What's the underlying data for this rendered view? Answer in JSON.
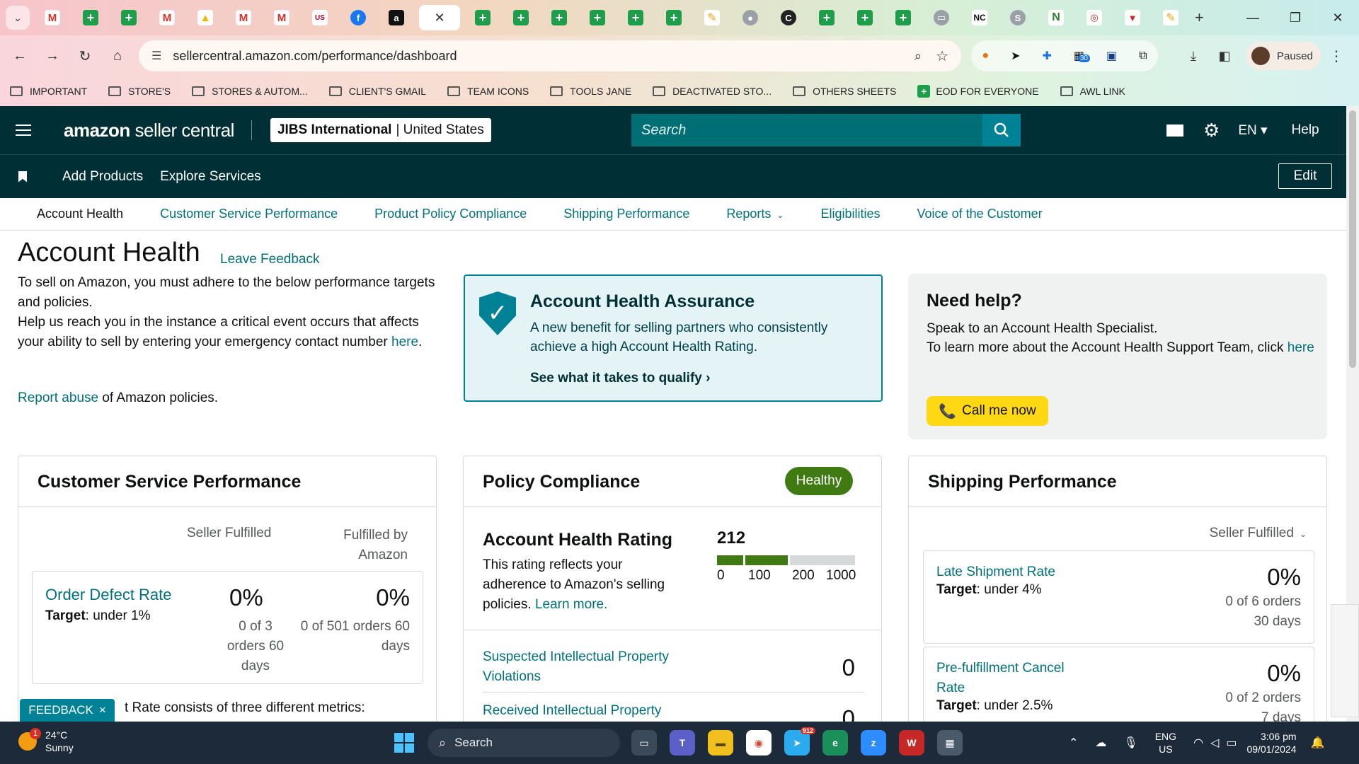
{
  "browser": {
    "url": "sellercentral.amazon.com/performance/dashboard",
    "profile_status": "Paused",
    "extension_badge": "30",
    "tabs": [
      {
        "icon": "gmail-icon",
        "glyph": "M",
        "kind": "gmail"
      },
      {
        "icon": "sheets-icon",
        "glyph": "+",
        "kind": "sheet"
      },
      {
        "icon": "sheets-icon",
        "glyph": "+",
        "kind": "sheet"
      },
      {
        "icon": "gmail-icon",
        "glyph": "M",
        "kind": "gmail"
      },
      {
        "icon": "drive-icon",
        "glyph": "▲",
        "kind": "drive"
      },
      {
        "icon": "gmail-icon",
        "glyph": "M",
        "kind": "gmail"
      },
      {
        "icon": "gmail-icon",
        "glyph": "M",
        "kind": "gmail"
      },
      {
        "icon": "usfoods-icon",
        "glyph": "US",
        "kind": "us"
      },
      {
        "icon": "facebook-icon",
        "glyph": "f",
        "kind": "fb"
      },
      {
        "icon": "amazon-icon",
        "glyph": "a",
        "kind": "amz"
      },
      {
        "icon": "sheets-icon",
        "glyph": "+",
        "kind": "sheet"
      },
      {
        "icon": "sheets-icon",
        "glyph": "+",
        "kind": "sheet"
      },
      {
        "icon": "sheets-icon",
        "glyph": "+",
        "kind": "sheet"
      },
      {
        "icon": "sheets-icon",
        "glyph": "+",
        "kind": "sheet"
      },
      {
        "icon": "sheets-icon",
        "glyph": "+",
        "kind": "sheet"
      },
      {
        "icon": "sheets-icon",
        "glyph": "+",
        "kind": "sheet"
      },
      {
        "icon": "zoho-icon",
        "glyph": "✎",
        "kind": "zoho"
      },
      {
        "icon": "globe-icon",
        "glyph": "●",
        "kind": "gray"
      },
      {
        "icon": "c-icon",
        "glyph": "C",
        "kind": "dark"
      },
      {
        "icon": "sheets-icon",
        "glyph": "+",
        "kind": "sheet"
      },
      {
        "icon": "sheets-icon",
        "glyph": "+",
        "kind": "sheet"
      },
      {
        "icon": "sheets-icon",
        "glyph": "+",
        "kind": "sheet"
      },
      {
        "icon": "car-icon",
        "glyph": "▭",
        "kind": "gray"
      },
      {
        "icon": "nc-icon",
        "glyph": "NC",
        "kind": "nc"
      },
      {
        "icon": "sysco-icon",
        "glyph": "S",
        "kind": "gray"
      },
      {
        "icon": "n-icon",
        "glyph": "N",
        "kind": "green"
      },
      {
        "icon": "target-icon",
        "glyph": "◎",
        "kind": "red"
      },
      {
        "icon": "shield-red-icon",
        "glyph": "▼",
        "kind": "red"
      },
      {
        "icon": "zoho-icon",
        "glyph": "✎",
        "kind": "zoho"
      }
    ],
    "bookmarks": [
      {
        "label": "IMPORTANT",
        "type": "folder"
      },
      {
        "label": "STORE'S",
        "type": "folder"
      },
      {
        "label": "STORES & AUTOM...",
        "type": "folder"
      },
      {
        "label": "CLIENT'S GMAIL",
        "type": "folder"
      },
      {
        "label": "TEAM ICONS",
        "type": "folder"
      },
      {
        "label": "TOOLS JANE",
        "type": "folder"
      },
      {
        "label": "DEACTIVATED STO...",
        "type": "folder"
      },
      {
        "label": "OTHERS SHEETS",
        "type": "folder"
      },
      {
        "label": "EOD FOR EVERYONE",
        "type": "sheet"
      },
      {
        "label": "AWL LINK",
        "type": "folder"
      }
    ]
  },
  "header": {
    "logo_bold": "amazon",
    "logo_light": " seller central",
    "store_name": "JIBS International",
    "store_region": "| United States",
    "search_placeholder": "Search",
    "language": "EN",
    "help": "Help"
  },
  "subnav": {
    "add_products": "Add Products",
    "explore_services": "Explore Services",
    "edit": "Edit"
  },
  "tabs": [
    {
      "label": "Account Health",
      "active": true
    },
    {
      "label": "Customer Service Performance"
    },
    {
      "label": "Product Policy Compliance"
    },
    {
      "label": "Shipping Performance"
    },
    {
      "label": "Reports",
      "dropdown": true
    },
    {
      "label": "Eligibilities"
    },
    {
      "label": "Voice of the Customer"
    }
  ],
  "page": {
    "title": "Account Health",
    "leave_feedback": "Leave Feedback",
    "intro_1": "To sell on Amazon, you must adhere to the below performance targets and policies.",
    "intro_2": "Help us reach you in the instance a critical event occurs that affects your ability to sell by entering your emergency contact number",
    "intro_link": "here",
    "report_link": "Report abuse",
    "report_rest": " of Amazon policies."
  },
  "assurance": {
    "title": "Account Health Assurance",
    "description": "A new benefit for selling partners who consistently achieve a high Account Health Rating.",
    "cta": "See what it takes to qualify"
  },
  "help_box": {
    "title": "Need help?",
    "line1": "Speak to an Account Health Specialist.",
    "line2": "To learn more about the Account Health Support Team, click",
    "link": "here",
    "button": "Call me now"
  },
  "customer_service": {
    "title": "Customer Service Performance",
    "col_seller": "Seller Fulfilled",
    "col_amazon": "Fulfilled by Amazon",
    "metric_name": "Order Defect Rate",
    "target_label": "Target",
    "target_value": ": under 1%",
    "seller_value": "0%",
    "seller_sub": "0 of 3 orders 60 days",
    "amazon_value": "0%",
    "amazon_sub": "0 of 501 orders 60 days",
    "footer_partial": "t Rate consists of three different metrics:"
  },
  "policy": {
    "title": "Policy Compliance",
    "status": "Healthy",
    "status_color": "#3f7b12",
    "ahr_title": "Account Health Rating",
    "ahr_desc": "This rating reflects your adherence to Amazon's selling policies.",
    "ahr_link": "Learn more.",
    "score": "212",
    "scale_ticks": [
      "0",
      "100",
      "200",
      "1000"
    ],
    "rows": [
      {
        "name": "Suspected Intellectual Property Violations",
        "value": "0"
      },
      {
        "name": "Received Intellectual Property",
        "value": "0"
      }
    ]
  },
  "shipping": {
    "title": "Shipping Performance",
    "filter": "Seller Fulfilled",
    "metrics": [
      {
        "name": "Late Shipment Rate",
        "target_label": "Target",
        "target_value": ": under 4%",
        "value": "0%",
        "sub1": "0 of 6 orders",
        "sub2": "30 days"
      },
      {
        "name": "Pre-fulfillment Cancel Rate",
        "target_label": "Target",
        "target_value": ": under 2.5%",
        "value": "0%",
        "sub1": "0 of 2 orders",
        "sub2": "7 days"
      }
    ]
  },
  "feedback_tab": {
    "label": "FEEDBACK",
    "close": "×"
  },
  "taskbar": {
    "temperature": "24°C",
    "condition": "Sunny",
    "weather_badge": "1",
    "search": "Search",
    "lang_1": "ENG",
    "lang_2": "US",
    "time": "3:06 pm",
    "date": "09/01/2024",
    "telegram_badge": "912"
  },
  "colors": {
    "header_bg": "#002f36",
    "link": "#00707d",
    "accent": "#008296",
    "call_button": "#ffd814"
  }
}
